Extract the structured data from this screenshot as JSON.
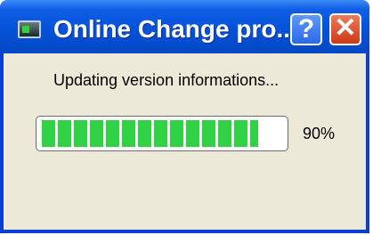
{
  "window": {
    "title": "Online Change pro...",
    "help_button": "?",
    "close_button": "✕"
  },
  "dialog": {
    "message": "Updating version informations...",
    "progress_percent": 90,
    "progress_label": "90%"
  },
  "colors": {
    "titlebar": "#0552d8",
    "client_background": "#ece9d8",
    "progress_fill": "#31d145",
    "close_button": "#cc3a14",
    "help_button": "#2a69e8"
  },
  "icons": {
    "app": "monitor-icon"
  }
}
